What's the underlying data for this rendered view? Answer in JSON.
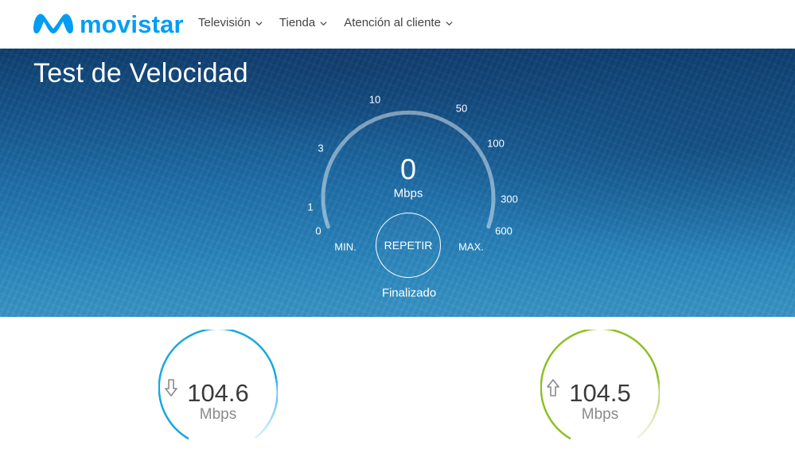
{
  "header": {
    "brand": "movistar",
    "brand_color": "#019df4",
    "nav": [
      {
        "label": "Televisión",
        "icon": "chevron-down-icon"
      },
      {
        "label": "Tienda",
        "icon": "chevron-down-icon"
      },
      {
        "label": "Atención al cliente",
        "icon": "chevron-down-icon"
      }
    ]
  },
  "hero": {
    "title": "Test de Velocidad",
    "scale_labels": [
      "0",
      "1",
      "3",
      "10",
      "50",
      "100",
      "300",
      "600"
    ],
    "current_speed": "0",
    "current_unit": "Mbps",
    "min_label": "MIN.",
    "max_label": "MAX.",
    "repeat_label": "REPETIR",
    "status": "Finalizado"
  },
  "results": {
    "download": {
      "value": "104.6",
      "unit": "Mbps",
      "icon": "arrow-down-icon",
      "color": "#1aa6e0"
    },
    "upload": {
      "value": "104.5",
      "unit": "Mbps",
      "icon": "arrow-up-icon",
      "color": "#8cbf26"
    }
  }
}
